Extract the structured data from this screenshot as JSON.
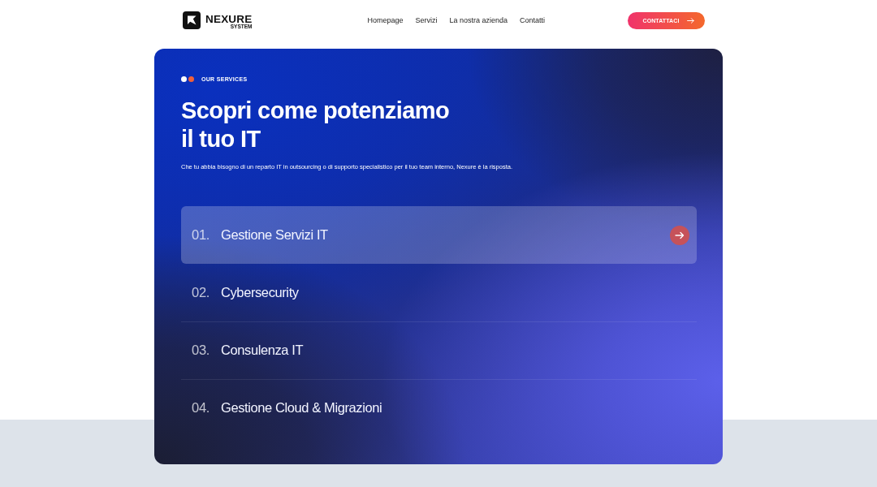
{
  "header": {
    "logo": {
      "name": "NEXURE",
      "tagline": "SYSTEM"
    },
    "nav": [
      {
        "label": "Homepage"
      },
      {
        "label": "Servizi"
      },
      {
        "label": "La nostra azienda"
      },
      {
        "label": "Contatti"
      }
    ],
    "cta": {
      "label": "CONTATTACI"
    }
  },
  "services_section": {
    "eyebrow": "OUR SERVICES",
    "heading": "Scopri come potenziamo\nil tuo IT",
    "description": "Che tu abbia bisogno di un reparto IT in outsourcing o di supporto specialistico per il tuo team interno, Nexure è la risposta.",
    "services": [
      {
        "number": "01.",
        "title": "Gestione Servizi IT",
        "selected": true
      },
      {
        "number": "02.",
        "title": "Cybersecurity",
        "selected": false
      },
      {
        "number": "03.",
        "title": "Consulenza IT",
        "selected": false
      },
      {
        "number": "04.",
        "title": "Gestione Cloud & Migrazioni",
        "selected": false
      }
    ]
  }
}
